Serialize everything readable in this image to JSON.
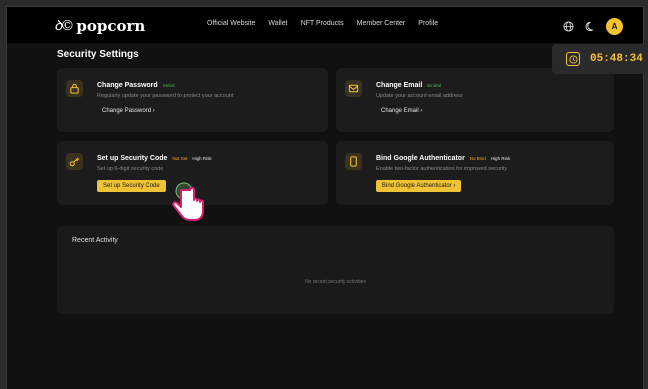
{
  "header": {
    "logo_mark": "ꝺ©",
    "logo_text": "popcorn",
    "nav": [
      "Official Website",
      "Wallet",
      "NFT Products",
      "Member Center",
      "Profile"
    ],
    "avatar_initial": "A"
  },
  "page_title": "Security Settings",
  "timer": "05:48:34",
  "cards": {
    "change_password": {
      "title": "Change Password",
      "status": "Seted",
      "desc": "Regularly update your password to protect your account",
      "action": "Change Password  ›"
    },
    "change_email": {
      "title": "Change Email",
      "status": "Binded",
      "desc": "Update your account email address",
      "action": "Change Email  ›"
    },
    "security_code": {
      "title": "Set up Security Code",
      "status": "Not Set",
      "risk": "High Risk",
      "desc": "Set up 6-digit security code",
      "action": "Set up Security Code"
    },
    "google_auth": {
      "title": "Bind Google Authenticator",
      "status": "No Bind",
      "risk": "High Risk",
      "desc": "Enable two-factor authentication for improved security",
      "action": "Bind Google Authenticator  ›"
    }
  },
  "activity": {
    "title": "Recent Activity",
    "empty": "No recent security activities"
  },
  "colors": {
    "accent": "#f5c330",
    "success": "#4caf50",
    "warning": "#f5a623",
    "background": "#111111",
    "card": "#1c1c1c"
  },
  "icons": [
    "globe-icon",
    "moon-icon",
    "clock-icon",
    "lock-icon",
    "mail-icon",
    "key-icon",
    "phone-icon",
    "hand-cursor-icon"
  ]
}
